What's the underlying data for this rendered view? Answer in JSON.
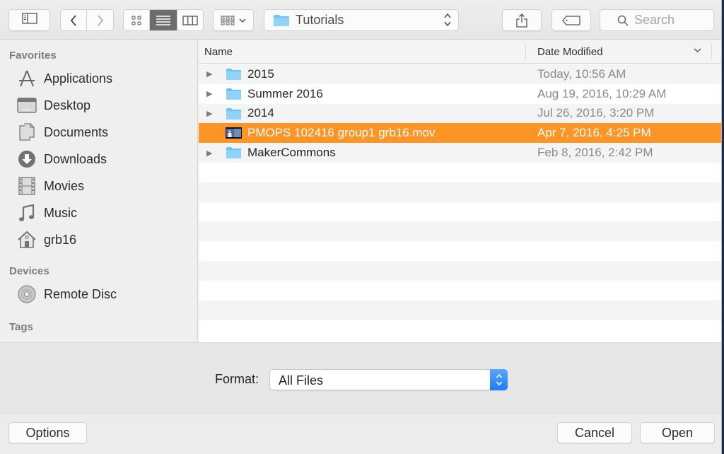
{
  "toolbar": {
    "path_label": "Tutorials",
    "search_placeholder": "Search",
    "view_mode_active": "list"
  },
  "sidebar": {
    "sections": {
      "favorites": "Favorites",
      "devices": "Devices",
      "tags": "Tags"
    },
    "favorites": [
      {
        "label": "Applications",
        "icon": "applications-icon"
      },
      {
        "label": "Desktop",
        "icon": "desktop-icon"
      },
      {
        "label": "Documents",
        "icon": "documents-icon"
      },
      {
        "label": "Downloads",
        "icon": "downloads-icon"
      },
      {
        "label": "Movies",
        "icon": "movies-icon"
      },
      {
        "label": "Music",
        "icon": "music-icon"
      },
      {
        "label": "grb16",
        "icon": "home-icon"
      }
    ],
    "devices": [
      {
        "label": "Remote Disc",
        "icon": "disc-icon"
      }
    ]
  },
  "filelist": {
    "columns": {
      "name": "Name",
      "date": "Date Modified"
    },
    "rows": [
      {
        "name": "2015",
        "date": "Today, 10:56 AM",
        "type": "folder",
        "selected": false
      },
      {
        "name": "Summer 2016",
        "date": "Aug 19, 2016, 10:29 AM",
        "type": "folder",
        "selected": false
      },
      {
        "name": "2014",
        "date": "Jul 26, 2016, 3:20 PM",
        "type": "folder",
        "selected": false
      },
      {
        "name": "PMOPS 102416 group1 grb16.mov",
        "date": "Apr 7, 2016, 4:25 PM",
        "type": "movie",
        "selected": true
      },
      {
        "name": "MakerCommons",
        "date": "Feb 8, 2016, 2:42 PM",
        "type": "folder",
        "selected": false
      }
    ]
  },
  "accessory": {
    "format_label": "Format:",
    "format_value": "All Files"
  },
  "buttons": {
    "options": "Options",
    "cancel": "Cancel",
    "open": "Open"
  },
  "colors": {
    "selection": "#fd9426",
    "folder": "#6cc4f5",
    "accent_blue": "#1f7cf7"
  }
}
